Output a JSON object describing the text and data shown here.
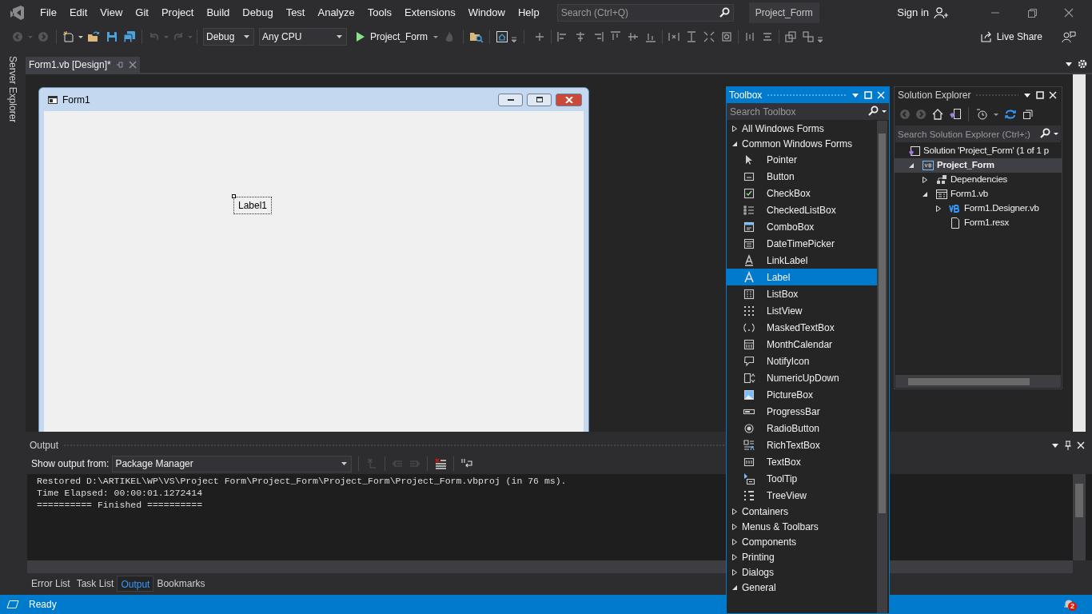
{
  "menu": [
    "File",
    "Edit",
    "View",
    "Git",
    "Project",
    "Build",
    "Debug",
    "Test",
    "Analyze",
    "Tools",
    "Extensions",
    "Window",
    "Help"
  ],
  "search": {
    "placeholder": "Search (Ctrl+Q)"
  },
  "solution_name": "Project_Form",
  "sign_in": "Sign in",
  "toolbar": {
    "configuration": "Debug",
    "platform": "Any CPU",
    "start": "Project_Form",
    "live_share": "Live Share"
  },
  "side_tabs": [
    "Server Explorer"
  ],
  "document_tabs": [
    {
      "label": "Form1.vb [Design]*",
      "selected": true
    }
  ],
  "form": {
    "title": "Form1",
    "label": "Label1"
  },
  "toolbox": {
    "title": "Toolbox",
    "search_placeholder": "Search Toolbox",
    "groups": [
      {
        "label": "All Windows Forms",
        "expanded": false
      },
      {
        "label": "Common Windows Forms",
        "expanded": true,
        "items": [
          {
            "label": "Pointer",
            "selected": false
          },
          {
            "label": "Button",
            "selected": false
          },
          {
            "label": "CheckBox",
            "selected": false
          },
          {
            "label": "CheckedListBox",
            "selected": false
          },
          {
            "label": "ComboBox",
            "selected": false
          },
          {
            "label": "DateTimePicker",
            "selected": false
          },
          {
            "label": "LinkLabel",
            "selected": false
          },
          {
            "label": "Label",
            "selected": true
          },
          {
            "label": "ListBox",
            "selected": false
          },
          {
            "label": "ListView",
            "selected": false
          },
          {
            "label": "MaskedTextBox",
            "selected": false
          },
          {
            "label": "MonthCalendar",
            "selected": false
          },
          {
            "label": "NotifyIcon",
            "selected": false
          },
          {
            "label": "NumericUpDown",
            "selected": false
          },
          {
            "label": "PictureBox",
            "selected": false
          },
          {
            "label": "ProgressBar",
            "selected": false
          },
          {
            "label": "RadioButton",
            "selected": false
          },
          {
            "label": "RichTextBox",
            "selected": false
          },
          {
            "label": "TextBox",
            "selected": false
          },
          {
            "label": "ToolTip",
            "selected": false
          },
          {
            "label": "TreeView",
            "selected": false
          }
        ]
      },
      {
        "label": "Containers",
        "expanded": false
      },
      {
        "label": "Menus & Toolbars",
        "expanded": false
      },
      {
        "label": "Components",
        "expanded": false
      },
      {
        "label": "Printing",
        "expanded": false
      },
      {
        "label": "Dialogs",
        "expanded": false
      },
      {
        "label": "General",
        "expanded": true
      }
    ]
  },
  "solution_explorer": {
    "title": "Solution Explorer",
    "search_placeholder": "Search Solution Explorer (Ctrl+;)",
    "tree": [
      {
        "label": "Solution 'Project_Form' (1 of 1 p",
        "kind": "solution",
        "selected": false,
        "children": [
          {
            "label": "Project_Form",
            "kind": "project",
            "selected": true,
            "expanded": true,
            "children": [
              {
                "label": "Dependencies",
                "kind": "dependencies",
                "selected": false,
                "expanded": false
              },
              {
                "label": "Form1.vb",
                "kind": "form",
                "selected": false,
                "expanded": true,
                "children": [
                  {
                    "label": "Form1.Designer.vb",
                    "kind": "vb",
                    "selected": false,
                    "expanded": false
                  },
                  {
                    "label": "Form1.resx",
                    "kind": "file",
                    "selected": false
                  }
                ]
              }
            ]
          }
        ]
      }
    ]
  },
  "output": {
    "title": "Output",
    "show_from_label": "Show output from:",
    "source": "Package Manager",
    "lines": [
      "Restored D:\\ARTIKEL\\WP\\VS\\Project Form\\Project_Form\\Project_Form\\Project_Form.vbproj (in 76 ms).",
      "Time Elapsed: 00:00:01.1272414",
      "========== Finished =========="
    ]
  },
  "bottom_tabs": [
    {
      "label": "Error List",
      "selected": false
    },
    {
      "label": "Task List",
      "selected": false
    },
    {
      "label": "Output",
      "selected": true
    },
    {
      "label": "Bookmarks",
      "selected": false
    }
  ],
  "status_bar": {
    "text": "Ready",
    "notifications": "2"
  }
}
